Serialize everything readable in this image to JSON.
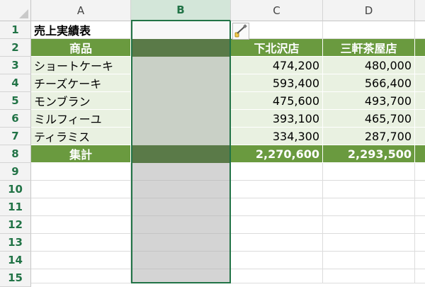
{
  "columns": [
    "A",
    "B",
    "C",
    "D"
  ],
  "rows": [
    "1",
    "2",
    "3",
    "4",
    "5",
    "6",
    "7",
    "8",
    "9",
    "10",
    "11",
    "12",
    "13",
    "14",
    "15"
  ],
  "title": "売上実績表",
  "headers": {
    "product": "商品",
    "store1": "下北沢店",
    "store2": "三軒茶屋店"
  },
  "items": [
    {
      "name": "ショートケーキ",
      "c": "474,200",
      "d": "480,000"
    },
    {
      "name": "チーズケーキ",
      "c": "593,400",
      "d": "566,400"
    },
    {
      "name": "モンブラン",
      "c": "475,600",
      "d": "493,700"
    },
    {
      "name": "ミルフィーユ",
      "c": "393,100",
      "d": "465,700"
    },
    {
      "name": "ティラミス",
      "c": "334,300",
      "d": "287,700"
    }
  ],
  "total": {
    "label": "集計",
    "c": "2,270,600",
    "d": "2,293,500"
  },
  "selected_column": "B",
  "colors": {
    "header_green": "#6a9a3f",
    "body_green": "#e9f1e1",
    "accent": "#217346"
  },
  "icons": {
    "paste_options": "paintbrush-icon"
  }
}
